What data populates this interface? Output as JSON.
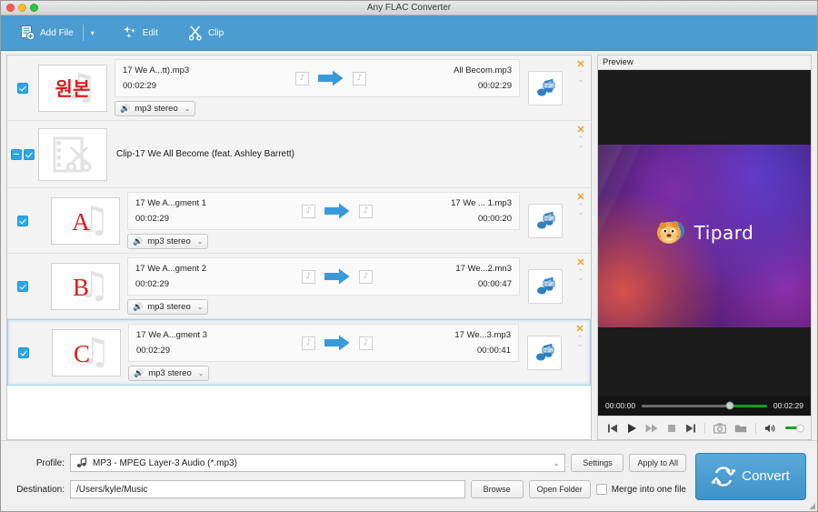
{
  "window": {
    "title": "Any FLAC Converter"
  },
  "toolbar": {
    "add_file": "Add File",
    "add_file_caret": "▾",
    "edit": "Edit",
    "clip": "Clip"
  },
  "preview": {
    "header": "Preview",
    "logo_text": "Tipard",
    "current_time": "00:00:00",
    "total_time": "00:02:29",
    "progress_percent": 70,
    "volume_percent": 100
  },
  "filelist": [
    {
      "kind": "file",
      "thumb_label": "원본",
      "source_name": "17 We A...tt).mp3",
      "source_time": "00:02:29",
      "target_name": "All Becom.mp3",
      "target_time": "00:02:29",
      "audio_track": "mp3 stereo",
      "checked": true,
      "selected": false
    },
    {
      "kind": "group",
      "thumb_label": "",
      "title": "Clip-17 We All Become (feat. Ashley Barrett)",
      "checked": true,
      "selected": false
    },
    {
      "kind": "file",
      "thumb_label": "A",
      "source_name": "17 We A...gment 1",
      "source_time": "00:02:29",
      "target_name": "17 We ... 1.mp3",
      "target_time": "00:00:20",
      "audio_track": "mp3 stereo",
      "checked": true,
      "selected": false
    },
    {
      "kind": "file",
      "thumb_label": "B",
      "source_name": "17 We A...gment 2",
      "source_time": "00:02:29",
      "target_name": "17 We...2.mn3",
      "target_time": "00:00:47",
      "audio_track": "mp3 stereo",
      "checked": true,
      "selected": false
    },
    {
      "kind": "file",
      "thumb_label": "C",
      "source_name": "17 We A...gment 3",
      "source_time": "00:02:29",
      "target_name": "17 We...3.mp3",
      "target_time": "00:00:41",
      "audio_track": "mp3 stereo",
      "checked": true,
      "selected": true
    }
  ],
  "bottom": {
    "profile_label": "Profile:",
    "profile_value": "MP3 - MPEG Layer-3 Audio (*.mp3)",
    "settings": "Settings",
    "apply_to_all": "Apply to All",
    "destination_label": "Destination:",
    "destination_value": "/Users/kyle/Music",
    "browse": "Browse",
    "open_folder": "Open Folder",
    "merge_label": "Merge into one file",
    "merge_checked": false,
    "convert": "Convert"
  },
  "colors": {
    "toolbar_blue": "#4a9cd1",
    "accent_blue": "#2ba7e8",
    "close_orange": "#f0a028",
    "progress_green": "#00a11e",
    "thumb_red": "#d01e1e"
  }
}
